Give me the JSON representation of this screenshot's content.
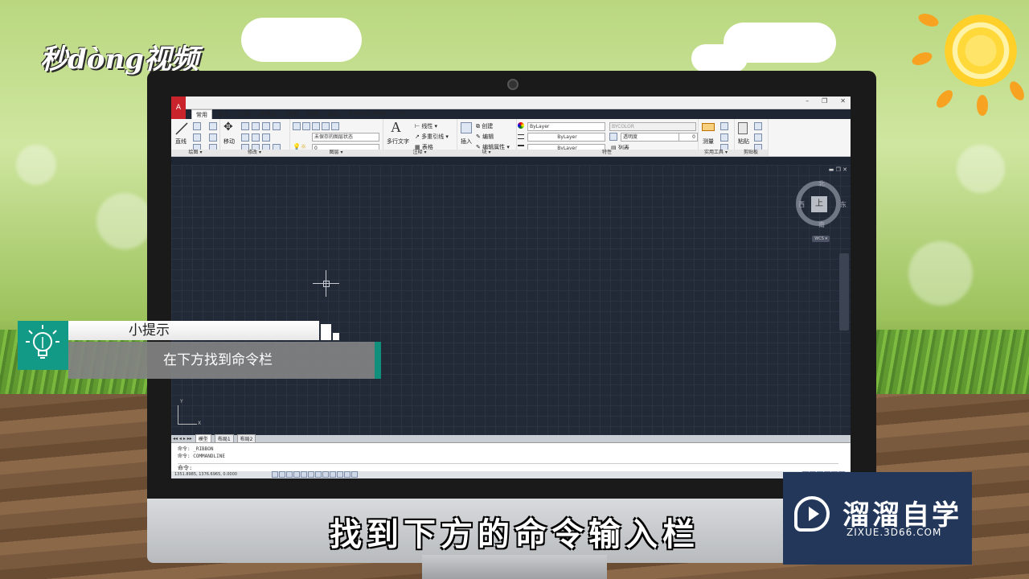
{
  "brand": {
    "logo_text": "秒dòng视频"
  },
  "app": {
    "tabs": [
      "常用",
      "插入",
      "注释",
      "参数化",
      "视图",
      "管理",
      "输出",
      "Express Tools"
    ],
    "active_tab": "常用",
    "panels": {
      "draw": {
        "title": "绘图 ▾",
        "tool": "直线"
      },
      "modify": {
        "title": "修改 ▾",
        "tool": "移动"
      },
      "layers": {
        "title": "图层 ▾",
        "state": "未保存的图层状态",
        "layer": "0"
      },
      "annotation": {
        "title": "注释 ▾",
        "tool": "多行文字",
        "items": [
          "线性 ▾",
          "多重引线 ▾",
          "表格"
        ]
      },
      "block": {
        "title": "块 ▾",
        "tool": "插入",
        "items": [
          "创建",
          "编辑",
          "编辑属性 ▾"
        ]
      },
      "properties": {
        "title": "特性",
        "color": "ByLayer",
        "linetype": "ByLayer",
        "lineweight": "ByLayer",
        "plot": "BYCOLOR",
        "transparency_label": "透明度",
        "transparency_value": "0",
        "list": "列表"
      },
      "utilities": {
        "title": "实用工具 ▾",
        "tool": "测量"
      },
      "clipboard": {
        "title": "剪贴板",
        "tool": "粘贴"
      }
    },
    "viewcube": {
      "face": "上",
      "north": "北",
      "south": "南",
      "east": "东",
      "west": "西",
      "wcs": "WCS ▾"
    },
    "ucs": {
      "x": "X",
      "y": "Y"
    },
    "layout_tabs": [
      "模型",
      "布局1",
      "布局2"
    ],
    "active_layout": "模型",
    "command_history": [
      "命令: _RIBBON",
      "命令: COMMANDLINE"
    ],
    "command_prompt": "命令:",
    "coordinates": "1351.8985, 1376.6965, 0.0000"
  },
  "tip": {
    "label": "小提示",
    "text": "在下方找到命令栏"
  },
  "subtitle": "找到下方的命令输入栏",
  "watermark": {
    "name": "溜溜自学",
    "url": "ZIXUE.3D66.COM"
  },
  "colors": {
    "accent": "#139a86",
    "canvas": "#222a38",
    "watermark_bg": "#22375a",
    "autocad_red": "#c9242b"
  }
}
